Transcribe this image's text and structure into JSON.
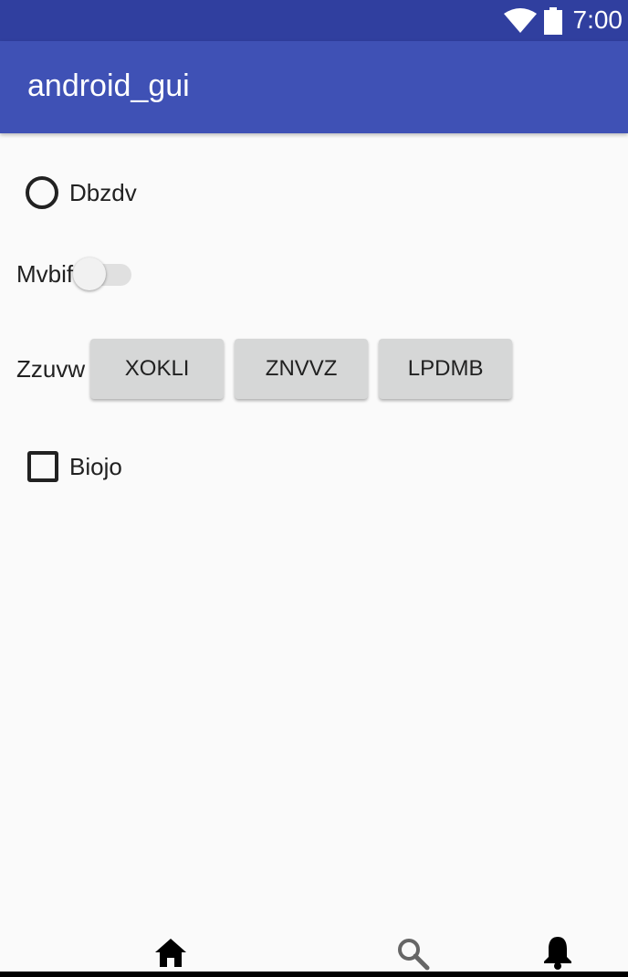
{
  "status_bar": {
    "time": "7:00",
    "icons": [
      "wifi-icon",
      "battery-icon"
    ],
    "color": "#303f9f"
  },
  "app_bar": {
    "title": "android_gui",
    "color": "#3f51b5"
  },
  "radio": {
    "label": "Dbzdv",
    "checked": false
  },
  "switch": {
    "label": "Mvbif",
    "on": false
  },
  "button_group": {
    "label": "Zzuvw",
    "buttons": [
      "XOKLI",
      "ZNVVZ",
      "LPDMB"
    ]
  },
  "checkbox": {
    "label": "Biojo",
    "checked": false
  },
  "bottom_nav": {
    "items": [
      "home-icon",
      "search-icon",
      "bell-icon"
    ]
  }
}
